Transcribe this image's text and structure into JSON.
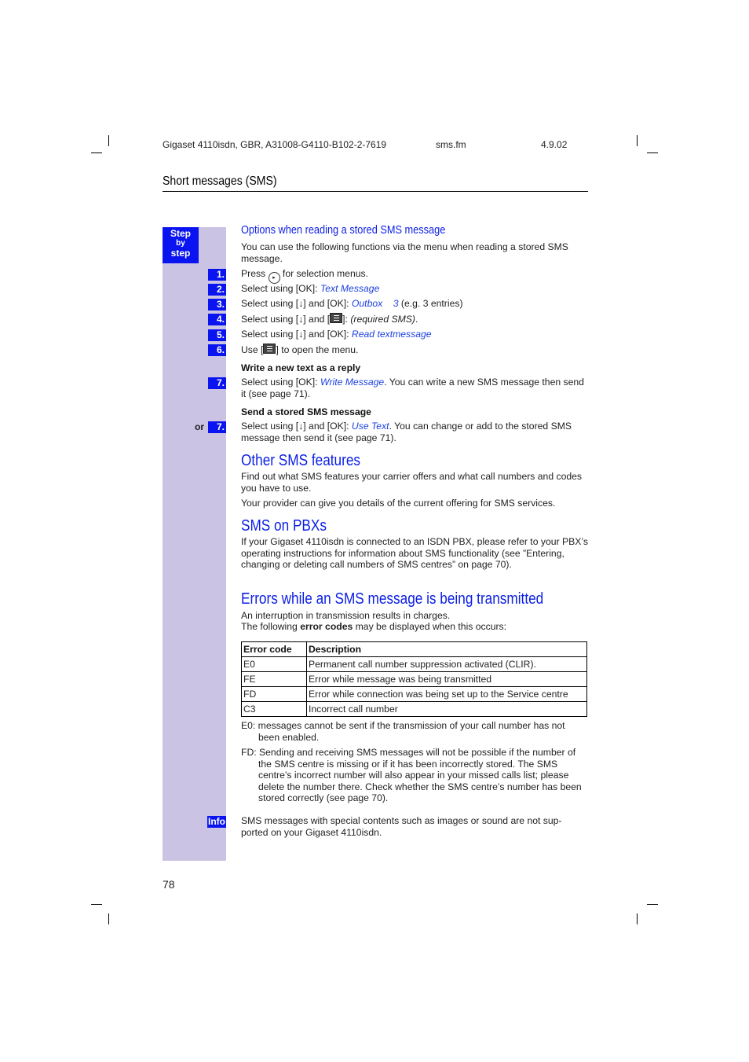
{
  "header": {
    "doc_id": "Gigaset 4110isdn, GBR, A31008-G4110-B102-2-7619",
    "file": "sms.fm",
    "date": "4.9.02"
  },
  "section_title": "Short messages (SMS)",
  "sidebar": {
    "step_label": [
      "Step",
      "by",
      "step"
    ],
    "info_label": "Info",
    "or_label": "or"
  },
  "options": {
    "heading": "Options when reading a stored SMS message",
    "intro": "You can use the following functions via the menu when reading a stored SMS message.",
    "steps": [
      {
        "num": "1.",
        "pre": "Press ",
        "icon": "navigation-key-icon",
        "post": " for selection menus."
      },
      {
        "num": "2.",
        "pre": "Select using [OK]: ",
        "link": "Text Message"
      },
      {
        "num": "3.",
        "pre": "Select using [",
        "arrow": "↓",
        "mid": "] and [OK]: ",
        "link": "Outbox",
        "link2": "3",
        "post": " (e.g. 3 entries)"
      },
      {
        "num": "4.",
        "pre": "Select using [",
        "arrow": "↓",
        "mid": "] and [",
        "icon": "menu-key-icon",
        "mid2": "]: ",
        "italic": "(required SMS)",
        "post": "."
      },
      {
        "num": "5.",
        "pre": "Select using [",
        "arrow": "↓",
        "mid": "] and [OK]: ",
        "link": "Read textmessage"
      },
      {
        "num": "6.",
        "pre": "Use [",
        "icon": "menu-key-icon",
        "post": "] to open the menu."
      }
    ],
    "reply": {
      "heading": "Write a new text as a reply",
      "num": "7.",
      "pre": "Select using [OK]: ",
      "link": "Write Message",
      "post": ". You can write a new SMS message then send it (see page 71)."
    },
    "send": {
      "heading": "Send a stored SMS message",
      "num": "7.",
      "pre": "Select using [",
      "arrow": "↓",
      "mid": "] and [OK]: ",
      "link": "Use Text",
      "post": ". You can change or add to the stored SMS message then send it (see page 71)."
    }
  },
  "other_features": {
    "heading": "Other SMS features",
    "p1": "Find out what SMS features your carrier offers and what call numbers and codes you have to use.",
    "p2": "Your provider can give you details of the current offering for SMS services."
  },
  "pbx": {
    "heading": "SMS on PBXs",
    "p1": "If your Gigaset 4110isdn is connected to an ISDN PBX, please refer to your PBX’s operating instructions for information about SMS functionality (see ”Entering, changing or deleting call numbers of SMS centres” on page 70)."
  },
  "errors": {
    "heading": "Errors while an SMS message is being transmitted",
    "line1": "An interruption in transmission results in charges.",
    "line2_pre": "The following ",
    "line2_bold": "error codes",
    "line2_post": " may be displayed when this occurs:",
    "table": {
      "headers": [
        "Error code",
        "Description"
      ],
      "rows": [
        [
          "E0",
          "Permanent call number suppression activated (CLIR)."
        ],
        [
          "FE",
          "Error while  message was being transmitted"
        ],
        [
          "FD",
          "Error while connection was being set up to the Service centre"
        ],
        [
          "C3",
          "Incorrect  call number"
        ]
      ]
    },
    "note_e0": "E0:  messages cannot be sent if the transmission of your call number has not been enabled.",
    "note_fd": "FD: Sending and receiving SMS messages will not be possible if the number of the SMS centre is missing or if it has been incorrectly stored. The SMS centre’s incorrect number will also appear in your missed calls list; please delete the number there. Check whether the SMS centre’s number has been stored correctly (see page 70)."
  },
  "info_text": "SMS messages with special contents such as images or sound are not sup-ported on your Gigaset 4110isdn.",
  "page_number": "78"
}
